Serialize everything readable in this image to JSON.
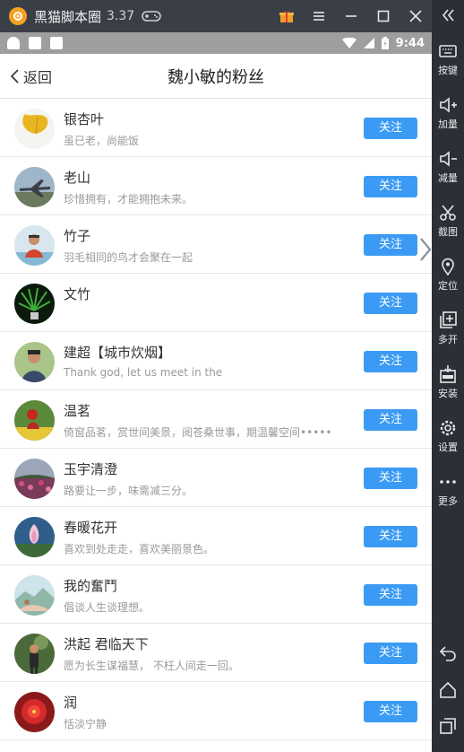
{
  "emulator": {
    "title": "黑猫脚本圈",
    "version": "3.37"
  },
  "status_bar": {
    "time": "9:44"
  },
  "header": {
    "back_label": "返回",
    "title": "魏小敏的粉丝"
  },
  "follow_label": "关注",
  "fans": [
    {
      "name": "银杏叶",
      "signature": "虽已老，尚能饭",
      "avatar_icon": "ginkgo-leaf"
    },
    {
      "name": "老山",
      "signature": "珍惜拥有，才能拥抱未来。",
      "avatar_icon": "airplane"
    },
    {
      "name": "竹子",
      "signature": "羽毛相同的鸟才会聚在一起",
      "avatar_icon": "person-photo"
    },
    {
      "name": "文竹",
      "signature": "",
      "avatar_icon": "green-plant"
    },
    {
      "name": "建超【城市炊烟】",
      "signature": "Thank god, let us meet in the",
      "avatar_icon": "person-photo"
    },
    {
      "name": "温茗",
      "signature": "倚窗品茗，赏世间美景，阅苍桑世事，期温馨空间••••••",
      "avatar_icon": "flowers"
    },
    {
      "name": "玉宇清澄",
      "signature": "路要让一步，味需减三分。",
      "avatar_icon": "flower-field"
    },
    {
      "name": "春暖花开",
      "signature": "喜欢到处走走，喜欢美丽景色。",
      "avatar_icon": "lotus"
    },
    {
      "name": "我的奮鬥",
      "signature": "倡谈人生谈理想。",
      "avatar_icon": "landscape"
    },
    {
      "name": "洪起 君临天下",
      "signature": "愿为长生谋福慧， 不枉人间走一回。",
      "avatar_icon": "person-photo"
    },
    {
      "name": "润",
      "signature": "恬淡宁静",
      "avatar_icon": "red-flower"
    }
  ],
  "sidebar": {
    "items": [
      {
        "label": "按键",
        "icon": "keyboard-icon"
      },
      {
        "label": "加量",
        "icon": "volume-up-icon"
      },
      {
        "label": "减量",
        "icon": "volume-down-icon"
      },
      {
        "label": "截图",
        "icon": "scissors-icon"
      },
      {
        "label": "定位",
        "icon": "location-icon"
      },
      {
        "label": "多开",
        "icon": "multi-open-icon"
      },
      {
        "label": "安装",
        "icon": "apk-install-icon"
      },
      {
        "label": "设置",
        "icon": "gear-icon"
      },
      {
        "label": "更多",
        "icon": "more-icon"
      }
    ]
  },
  "colors": {
    "accent": "#3b9bf4",
    "status_bar": "#9e9e9e",
    "emulator_chrome": "#3a3f47"
  }
}
